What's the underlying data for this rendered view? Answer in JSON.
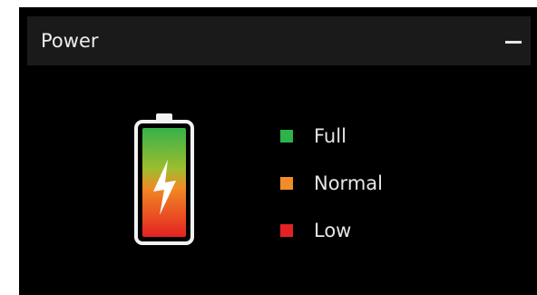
{
  "header": {
    "title": "Power"
  },
  "icons": {
    "collapse": "minus-icon",
    "battery": "battery-charging-icon"
  },
  "legend": {
    "items": [
      {
        "label": "Full",
        "color": "#2db34a"
      },
      {
        "label": "Normal",
        "color": "#f28c28"
      },
      {
        "label": "Low",
        "color": "#e42222"
      }
    ]
  }
}
